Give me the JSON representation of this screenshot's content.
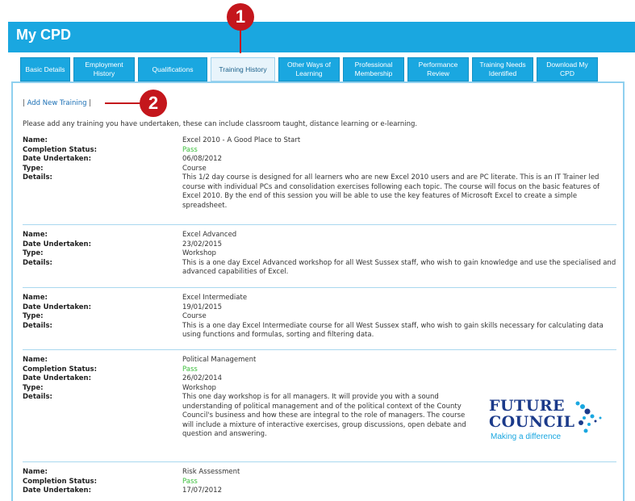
{
  "header": {
    "title": "My CPD"
  },
  "tabs": [
    {
      "label": "Basic Details"
    },
    {
      "label": "Employment History"
    },
    {
      "label": "Qualifications"
    },
    {
      "label": "Training History"
    },
    {
      "label": "Other Ways of Learning"
    },
    {
      "label": "Professional Membership"
    },
    {
      "label": "Performance Review"
    },
    {
      "label": "Training Needs Identified"
    },
    {
      "label": "Download My CPD"
    }
  ],
  "actions": {
    "pre": "| ",
    "add_training": "Add New Training",
    "post": " |"
  },
  "intro": "Please add any training you have undertaken, these can include classroom taught, distance learning or e-learning.",
  "labels": {
    "name": "Name:",
    "status": "Completion Status:",
    "date": "Date Undertaken:",
    "type": "Type:",
    "details": "Details:"
  },
  "records": [
    {
      "name": "Excel 2010 - A Good Place to Start",
      "status": "Pass",
      "date": "06/08/2012",
      "type": "Course",
      "details": "This 1/2 day course is designed for all learners who are new Excel 2010 users and are PC literate. This is an IT Trainer led course with individual PCs and consolidation exercises following each topic. The course will focus on the basic features of Excel 2010. By the end of this session you will be able to use the key features of Microsoft Excel to create a simple spreadsheet."
    },
    {
      "name": "Excel Advanced",
      "date": "23/02/2015",
      "type": "Workshop",
      "details": "This is a one day Excel Advanced workshop for all West Sussex staff, who wish to gain knowledge and use the specialised and advanced capabilities of Excel."
    },
    {
      "name": "Excel Intermediate",
      "date": "19/01/2015",
      "type": "Course",
      "details": "This is a one day Excel Intermediate course for all West Sussex staff, who wish to gain skills necessary for calculating data using functions and formulas, sorting and filtering data."
    },
    {
      "name": "Political Management",
      "status": "Pass",
      "date": "26/02/2014",
      "type": "Workshop",
      "details": "This one day workshop is for all managers. It will provide you with a sound understanding of political management and of the political context of the County Council's business and how these are integral to the role of managers. The course will include a mixture of interactive exercises, group discussions, open debate and question and answering."
    },
    {
      "name": "Risk Assessment",
      "status": "Pass",
      "date": "17/07/2012"
    }
  ],
  "logo": {
    "line1": "FUTURE",
    "line2": "COUNCIL",
    "tagline": "Making a difference"
  },
  "callouts": [
    "1",
    "2"
  ],
  "colors": {
    "brand_blue": "#1aa7e0",
    "pass_green": "#3cbf3c",
    "callout_red": "#c4161c",
    "logo_navy": "#1b3a8a"
  }
}
